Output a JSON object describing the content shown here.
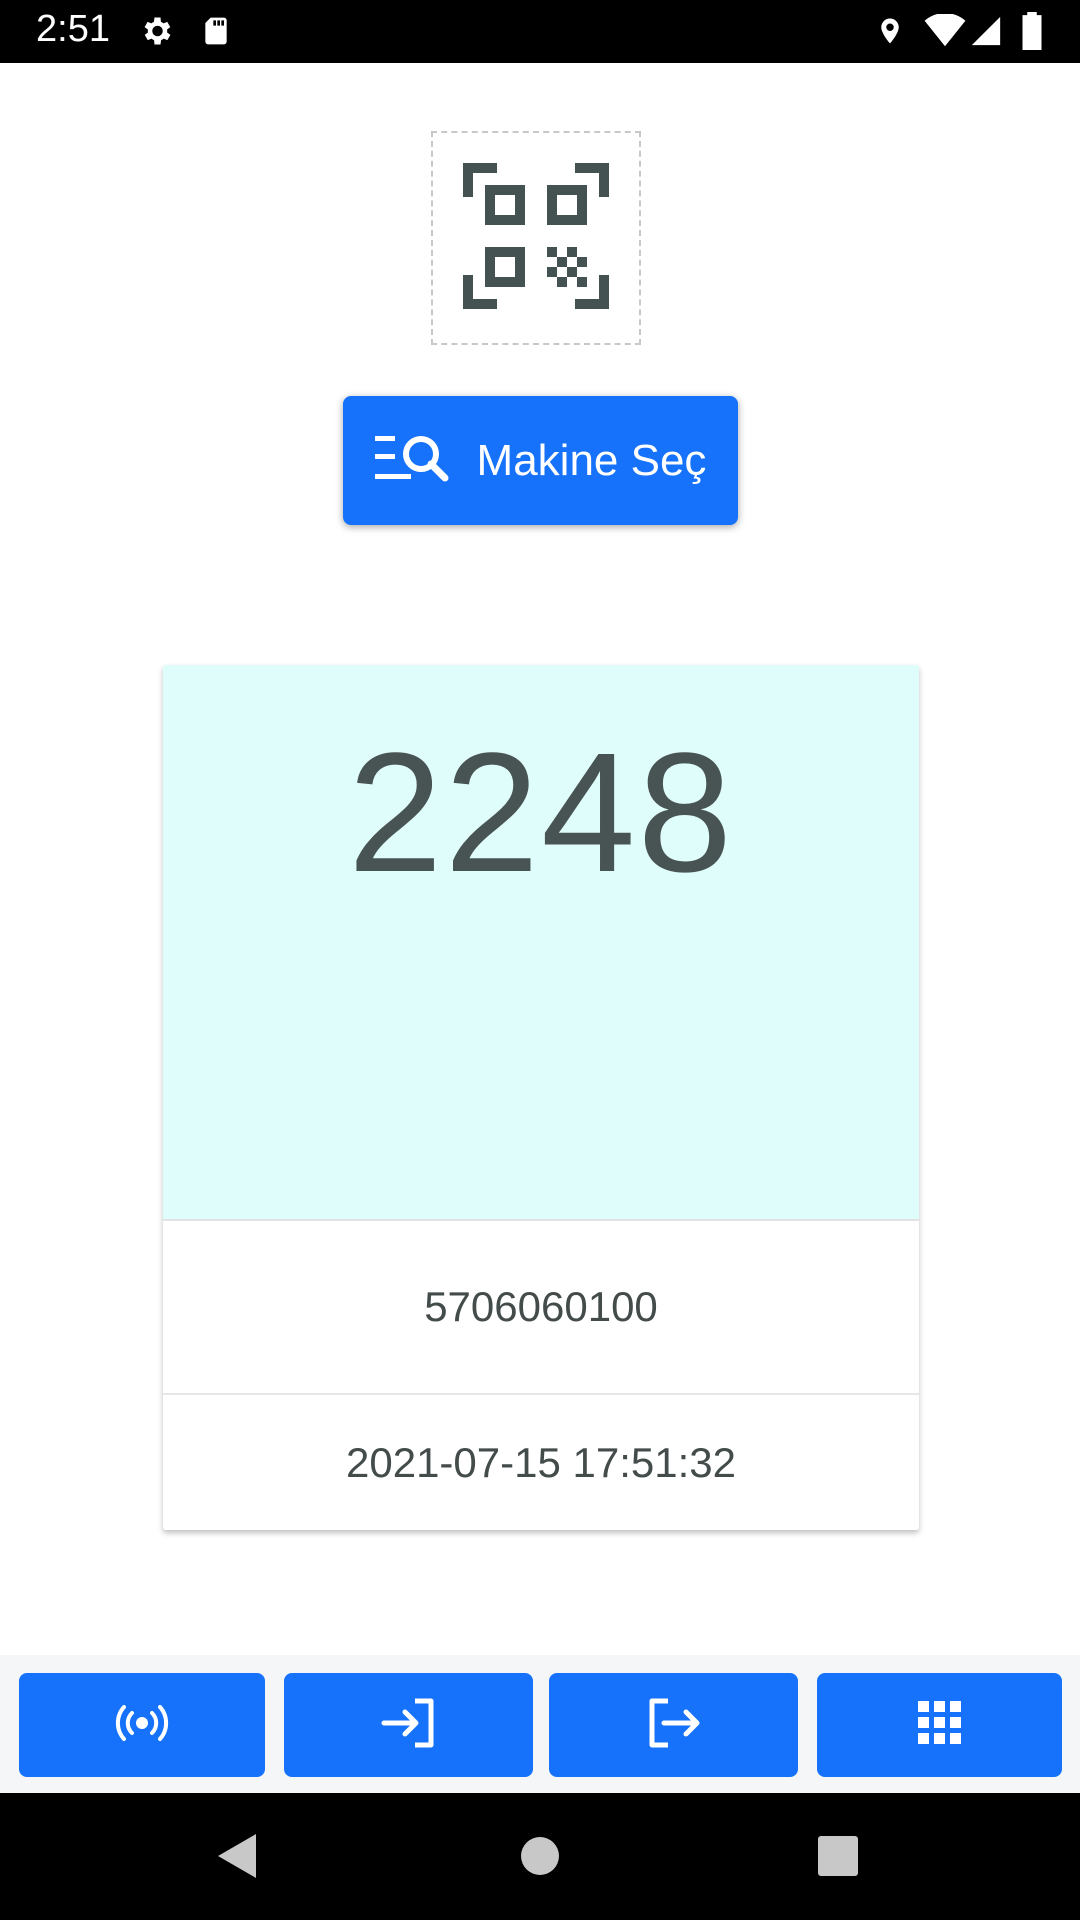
{
  "status_bar": {
    "time": "2:51",
    "icons": [
      "gear-icon",
      "sd-card-icon",
      "location-icon",
      "wifi-icon",
      "cell-signal-icon",
      "battery-icon"
    ]
  },
  "qr": {
    "icon": "qr-scan-icon"
  },
  "select_button": {
    "label": "Makine Seç",
    "icon": "list-search-icon"
  },
  "card": {
    "count": "2248",
    "code": "5706060100",
    "timestamp": "2021-07-15 17:51:32",
    "top_color": "#dffdfb"
  },
  "bottom_actions": [
    {
      "name": "broadcast-button",
      "icon": "broadcast-icon"
    },
    {
      "name": "login-button",
      "icon": "login-icon"
    },
    {
      "name": "logout-button",
      "icon": "logout-icon"
    },
    {
      "name": "grid-button",
      "icon": "grid-icon"
    }
  ],
  "colors": {
    "accent": "#1672fa",
    "icon_dark": "#455252"
  },
  "nav": [
    "back-icon",
    "home-icon",
    "recents-icon"
  ]
}
